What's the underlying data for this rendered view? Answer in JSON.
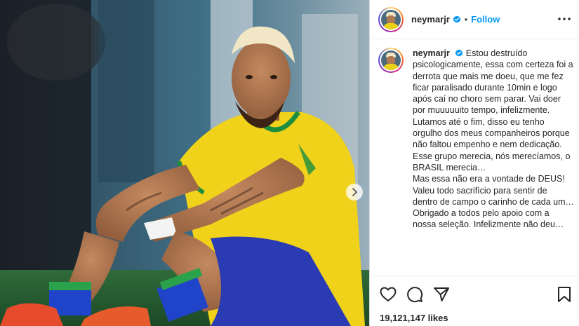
{
  "header": {
    "username": "neymarjr",
    "separator": "•",
    "follow_label": "Follow"
  },
  "caption": {
    "username": "neymarjr",
    "lines": [
      "Estou destruído psicologicamente, essa com certeza foi a derrota que mais me doeu, que me fez ficar paralisado durante 10min e logo após caí no choro sem parar. Vai doer por muuuuuito tempo, infelizmente.",
      "Lutamos até o fim, disso eu tenho orgulho dos meus companheiros porque não faltou empenho e nem dedicação.",
      "Esse grupo merecia, nós merecíamos, o BRASIL merecia…",
      "Mas essa não era a vontade de DEUS!",
      "Valeu todo sacrifício para sentir de dentro de campo o carinho de cada um…",
      "Obrigado a todos pelo apoio com a nossa seleção. Infelizmente não deu…"
    ]
  },
  "engagement": {
    "likes": "19,121,147 likes"
  },
  "icons": {
    "verified": "verified-badge-icon",
    "more": "more-options-icon",
    "like": "heart-icon",
    "comment": "comment-icon",
    "share": "send-icon",
    "save": "bookmark-icon",
    "next": "chevron-right-icon"
  },
  "colors": {
    "accent": "#0095f6",
    "jersey_yellow": "#f0d21a",
    "jersey_green": "#1e8e3e",
    "shorts_blue": "#2b3bb3"
  }
}
